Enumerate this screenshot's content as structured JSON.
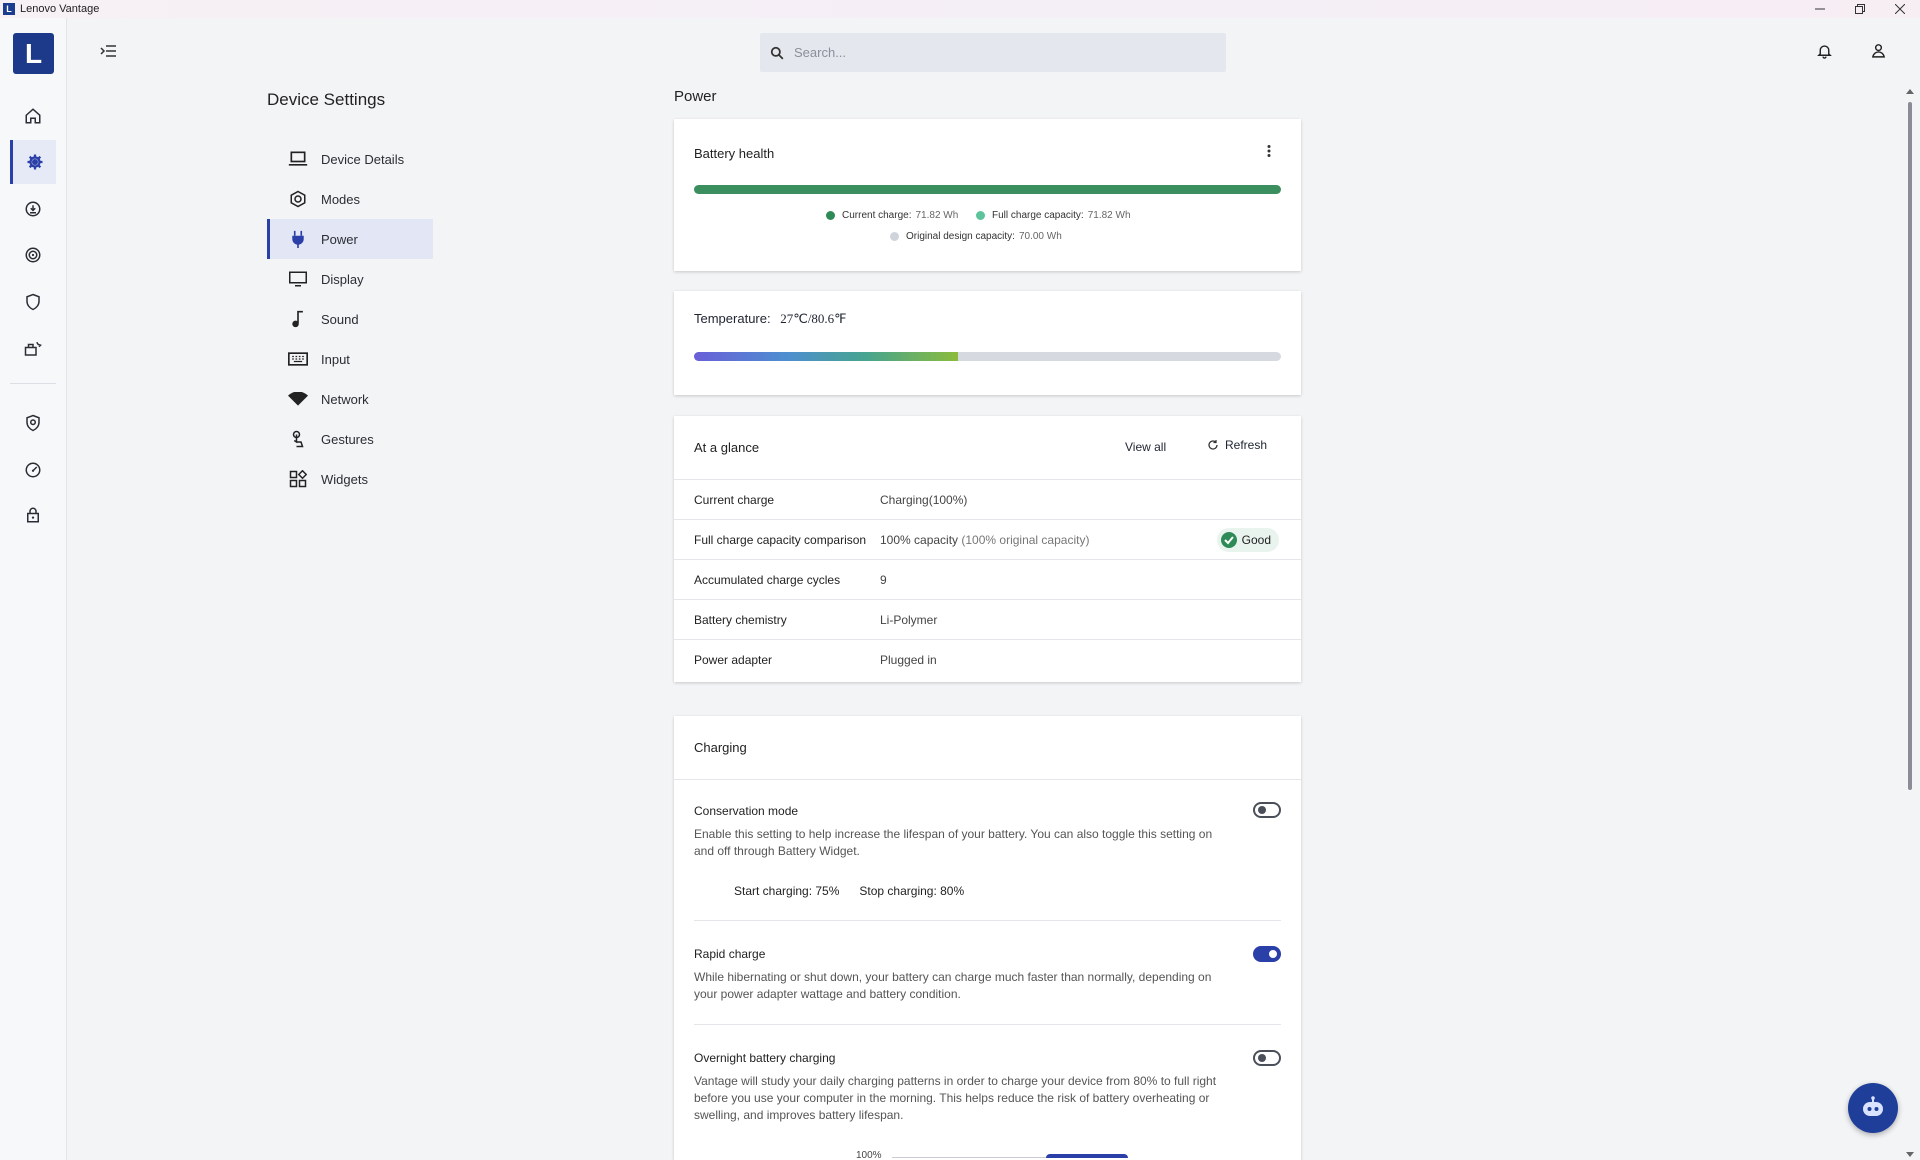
{
  "window": {
    "title": "Lenovo Vantage",
    "app_icon": "L"
  },
  "rail": {
    "logo": "L"
  },
  "search": {
    "placeholder": "Search..."
  },
  "section": {
    "title": "Device Settings"
  },
  "nav": {
    "items": [
      {
        "label": "Device Details",
        "icon": "laptop-icon"
      },
      {
        "label": "Modes",
        "icon": "modes-icon"
      },
      {
        "label": "Power",
        "icon": "plug-icon",
        "active": true
      },
      {
        "label": "Display",
        "icon": "monitor-icon"
      },
      {
        "label": "Sound",
        "icon": "music-note-icon"
      },
      {
        "label": "Input",
        "icon": "keyboard-icon"
      },
      {
        "label": "Network",
        "icon": "wifi-icon"
      },
      {
        "label": "Gestures",
        "icon": "gesture-icon"
      },
      {
        "label": "Widgets",
        "icon": "widgets-icon"
      }
    ]
  },
  "page": {
    "heading": "Power"
  },
  "battery_health": {
    "title": "Battery health",
    "legend": {
      "current_label": "Current charge:",
      "current_value": "71.82 Wh",
      "full_label": "Full charge capacity:",
      "full_value": "71.82 Wh",
      "design_label": "Original design capacity:",
      "design_value": "70.00 Wh"
    },
    "colors": {
      "current": "#2e8b57",
      "full": "#5cc39a",
      "design": "#cfd3dc"
    }
  },
  "temperature": {
    "label": "Temperature:",
    "value": "27℃/80.6℉",
    "level_fraction": 0.45
  },
  "glance": {
    "title": "At a glance",
    "view_all": "View all",
    "refresh": "Refresh",
    "rows": [
      {
        "label": "Current charge",
        "value": "Charging(100%)",
        "extra": ""
      },
      {
        "label": "Full charge capacity comparison",
        "value": "100% capacity",
        "extra": "(100% original capacity)",
        "badge": "Good"
      },
      {
        "label": "Accumulated charge cycles",
        "value": "9",
        "extra": ""
      },
      {
        "label": "Battery chemistry",
        "value": "Li-Polymer",
        "extra": ""
      },
      {
        "label": "Power adapter",
        "value": "Plugged in",
        "extra": ""
      }
    ]
  },
  "charging": {
    "title": "Charging",
    "conservation": {
      "title": "Conservation mode",
      "desc": "Enable this setting to help increase the lifespan of your battery. You can also toggle this setting on and off through Battery Widget.",
      "start": "Start charging: 75%",
      "stop": "Stop charging: 80%",
      "enabled": false
    },
    "rapid": {
      "title": "Rapid charge",
      "desc": "While hibernating or shut down, your battery can charge much faster than normally, depending on your power adapter wattage and battery condition.",
      "enabled": true
    },
    "overnight": {
      "title": "Overnight battery charging",
      "desc": "Vantage will study your daily charging patterns in order to charge your device from 80% to full right before you use your computer in the morning. This helps reduce the risk of battery overheating or swelling, and improves battery lifespan.",
      "enabled": false,
      "chart_tick": "100%"
    }
  }
}
